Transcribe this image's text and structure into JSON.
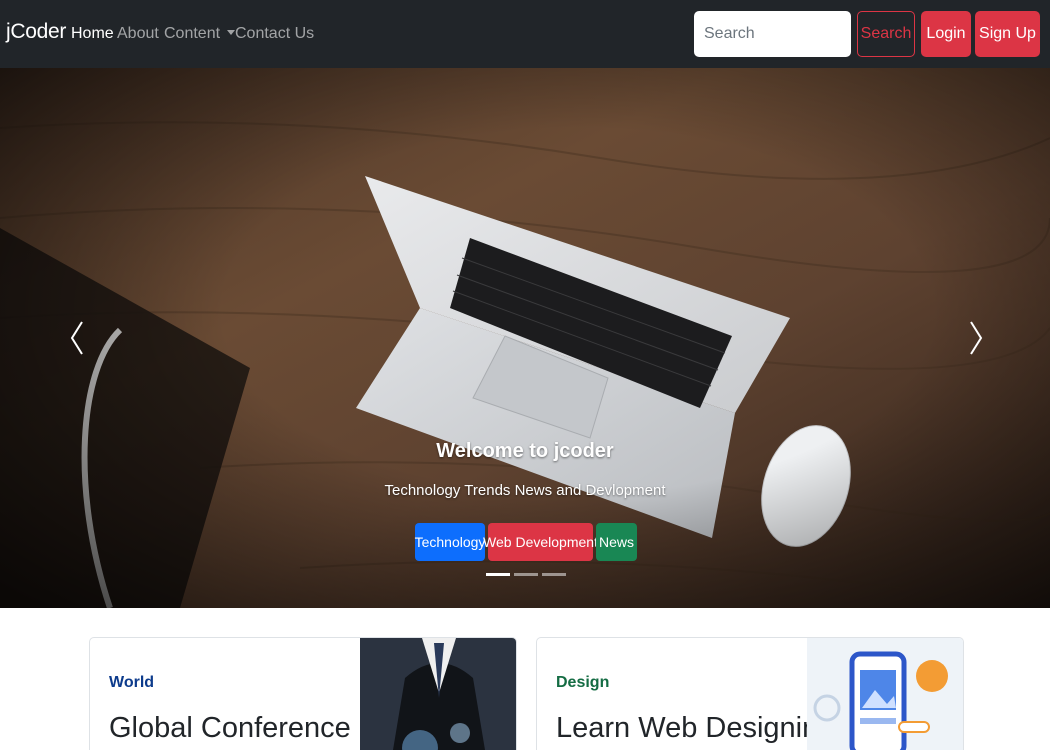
{
  "brand": "jCoder",
  "nav": {
    "home": "Home",
    "about": "About",
    "content": "Content",
    "contact": "Contact Us"
  },
  "search": {
    "placeholder": "Search",
    "button": "Search"
  },
  "auth": {
    "login": "Login",
    "signup": "Sign Up"
  },
  "hero": {
    "title": "Welcome to jcoder",
    "subtitle": "Technology Trends News and Devlopment",
    "categories": [
      "Technology",
      "Web Development",
      "News"
    ],
    "active_slide": 1,
    "slide_count": 3
  },
  "cards": [
    {
      "category": "World",
      "title": "Global Conference",
      "category_color": "#0d3b8c"
    },
    {
      "category": "Design",
      "title": "Learn Web Designing",
      "category_color": "#146c43"
    }
  ],
  "colors": {
    "navbar": "#212529",
    "danger": "#dc3545",
    "primary": "#0d6efd",
    "success": "#198754"
  },
  "icons": {
    "prev": "chevron-left-icon",
    "next": "chevron-right-icon"
  }
}
